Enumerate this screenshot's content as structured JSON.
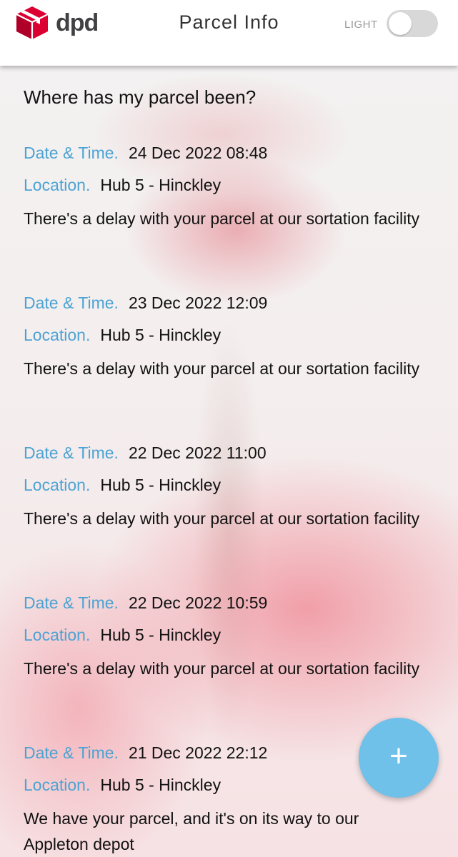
{
  "header": {
    "logo_text": "dpd",
    "title": "Parcel Info",
    "theme_label": "LIGHT",
    "theme_toggle_on": false
  },
  "heading": "Where has my parcel been?",
  "labels": {
    "datetime": "Date & Time.",
    "location": "Location."
  },
  "events": [
    {
      "datetime": "24 Dec 2022 08:48",
      "location": "Hub 5 - Hinckley",
      "description": "There's a delay with your parcel at our sortation facility"
    },
    {
      "datetime": "23 Dec 2022 12:09",
      "location": "Hub 5 - Hinckley",
      "description": "There's a delay with your parcel at our sortation facility"
    },
    {
      "datetime": "22 Dec 2022 11:00",
      "location": "Hub 5 - Hinckley",
      "description": "There's a delay with your parcel at our sortation facility"
    },
    {
      "datetime": "22 Dec 2022 10:59",
      "location": "Hub 5 - Hinckley",
      "description": "There's a delay with your parcel at our sortation facility"
    },
    {
      "datetime": "21 Dec 2022 22:12",
      "location": "Hub 5 - Hinckley",
      "description": "We have your parcel, and it's on its way to our Appleton depot"
    }
  ],
  "fab": {
    "label": "+",
    "icon": "plus-icon"
  },
  "colors": {
    "brand_red": "#dc0032",
    "label_blue": "#4ca3d3",
    "fab_blue": "#6fc1ea"
  }
}
